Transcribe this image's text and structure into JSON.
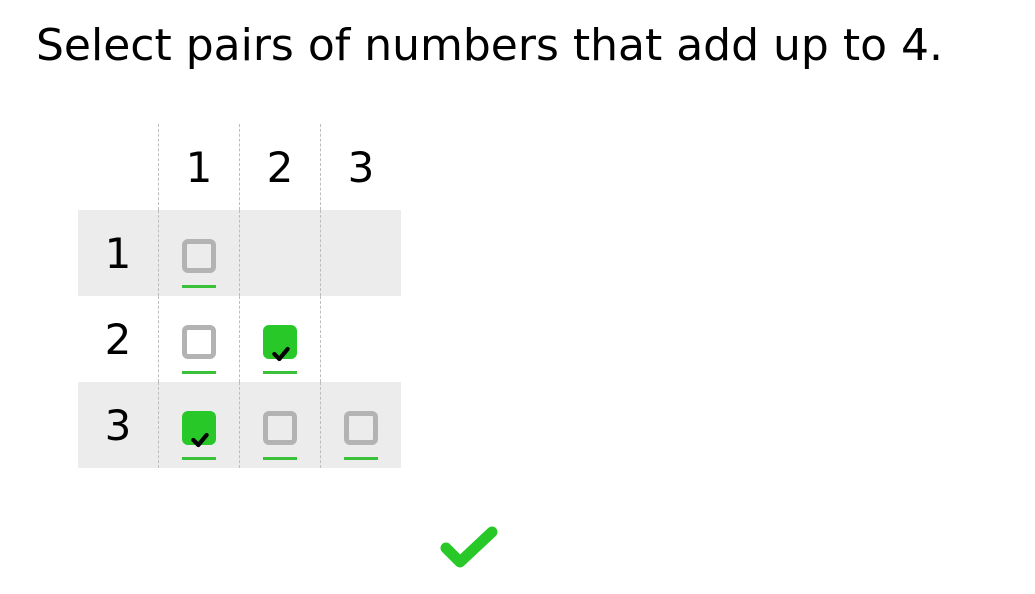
{
  "prompt": "Select pairs of numbers that add up to 4.",
  "col_headers": [
    "1",
    "2",
    "3"
  ],
  "row_headers": [
    "1",
    "2",
    "3"
  ],
  "cells": {
    "r1c1": {
      "present": true,
      "checked": false
    },
    "r1c2": {
      "present": false,
      "checked": false
    },
    "r1c3": {
      "present": false,
      "checked": false
    },
    "r2c1": {
      "present": true,
      "checked": false
    },
    "r2c2": {
      "present": true,
      "checked": true
    },
    "r2c3": {
      "present": false,
      "checked": false
    },
    "r3c1": {
      "present": true,
      "checked": true
    },
    "r3c2": {
      "present": true,
      "checked": false
    },
    "r3c3": {
      "present": true,
      "checked": false
    }
  },
  "colors": {
    "check_fill": "#28c828",
    "check_stroke": "#000000"
  }
}
